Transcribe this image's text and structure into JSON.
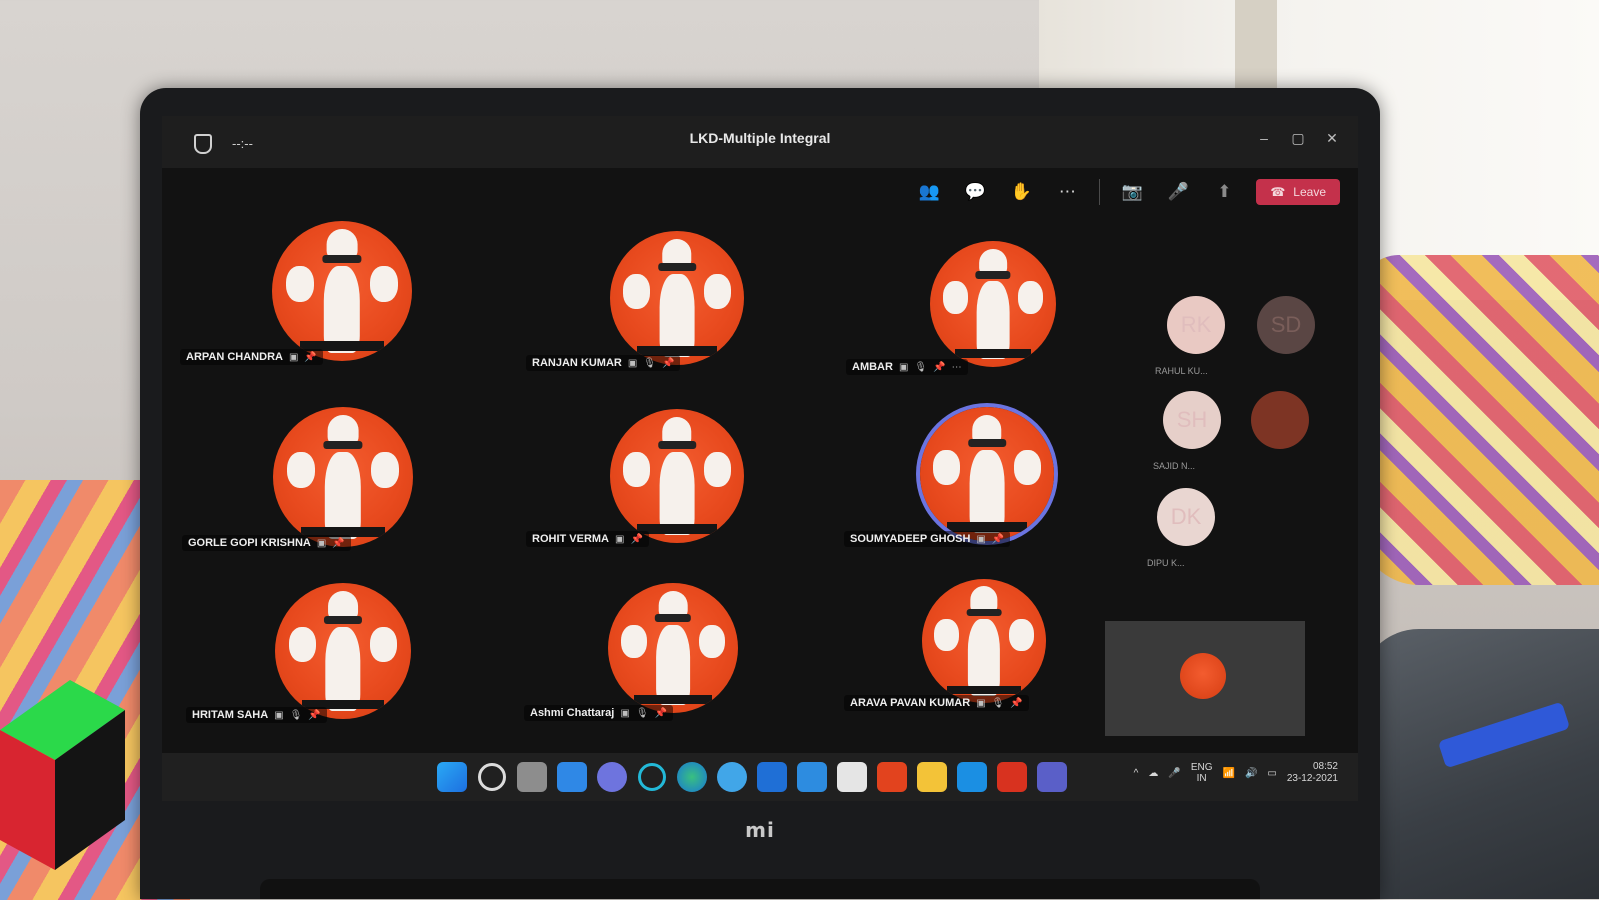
{
  "meeting": {
    "title": "LKD-Multiple Integral",
    "timer": "--:--",
    "leave_label": "Leave"
  },
  "toolbar": {
    "icons": [
      "people-icon",
      "chat-icon",
      "raise-hand-icon",
      "more-icon",
      "camera-off-icon",
      "mic-off-icon",
      "share-icon"
    ]
  },
  "participants": [
    {
      "name": "ARPAN CHANDRA"
    },
    {
      "name": "RANJAN KUMAR"
    },
    {
      "name": "AMBAR"
    },
    {
      "name": "GORLE GOPI KRISHNA"
    },
    {
      "name": "ROHIT VERMA"
    },
    {
      "name": "SOUMYADEEP GHOSH"
    },
    {
      "name": "HRITAM SAHA"
    },
    {
      "name": "Ashmi Chattaraj"
    },
    {
      "name": "ARAVA PAVAN KUMAR"
    }
  ],
  "side_participants": [
    {
      "initials": "RK",
      "name": "RAHUL KU..."
    },
    {
      "initials": "SD",
      "name": ""
    },
    {
      "initials": "SH",
      "name": "SAJID N..."
    },
    {
      "initials": "",
      "name": ""
    },
    {
      "initials": "DK",
      "name": "DIPU K..."
    }
  ],
  "taskbar": {
    "lang_top": "ENG",
    "lang_bottom": "IN",
    "time": "08:52",
    "date": "23-12-2021"
  },
  "device": {
    "brand": "mi"
  },
  "colors": {
    "avatar": "#e84a1e",
    "leave": "#c4314b",
    "speaking_ring": "#6b74e0"
  }
}
